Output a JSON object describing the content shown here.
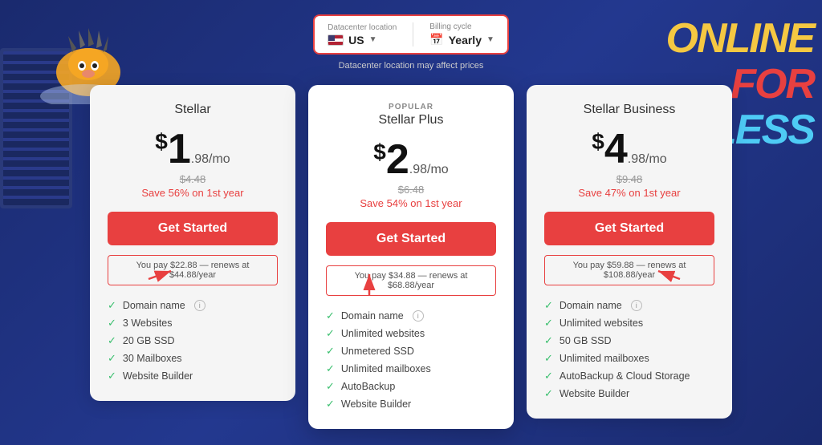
{
  "page": {
    "background_title_line1": "ONLINE",
    "background_title_line2": "FOR",
    "background_title_line3": "LESS"
  },
  "controls": {
    "datacenter_label": "Datacenter location",
    "datacenter_value": "US",
    "billing_label": "Billing cycle",
    "billing_value": "Yearly",
    "note": "Datacenter location may affect prices"
  },
  "plans": [
    {
      "id": "stellar",
      "popular": false,
      "name": "Stellar",
      "currency": "$",
      "price": "1",
      "price_decimal": ".98",
      "period": "/mo",
      "original_price": "$4.48",
      "save_text": "Save 56% on 1st year",
      "cta": "Get Started",
      "renews": "You pay $22.88 — renews at $44.88/year",
      "features": [
        {
          "text": "Domain name",
          "info": true
        },
        {
          "text": "3 Websites",
          "info": false
        },
        {
          "text": "20 GB SSD",
          "info": false
        },
        {
          "text": "30 Mailboxes",
          "info": false
        },
        {
          "text": "Website Builder",
          "info": false
        }
      ]
    },
    {
      "id": "stellar-plus",
      "popular": true,
      "popular_label": "POPULAR",
      "name": "Stellar Plus",
      "currency": "$",
      "price": "2",
      "price_decimal": ".98",
      "period": "/mo",
      "original_price": "$6.48",
      "save_text": "Save 54% on 1st year",
      "cta": "Get Started",
      "renews": "You pay $34.88 — renews at $68.88/year",
      "features": [
        {
          "text": "Domain name",
          "info": true
        },
        {
          "text": "Unlimited websites",
          "info": false
        },
        {
          "text": "Unmetered SSD",
          "info": false
        },
        {
          "text": "Unlimited mailboxes",
          "info": false
        },
        {
          "text": "AutoBackup",
          "info": false
        },
        {
          "text": "Website Builder",
          "info": false
        }
      ]
    },
    {
      "id": "stellar-business",
      "popular": false,
      "name": "Stellar Business",
      "currency": "$",
      "price": "4",
      "price_decimal": ".98",
      "period": "/mo",
      "original_price": "$9.48",
      "save_text": "Save 47% on 1st year",
      "cta": "Get Started",
      "renews": "You pay $59.88 — renews at $108.88/year",
      "features": [
        {
          "text": "Domain name",
          "info": true
        },
        {
          "text": "Unlimited websites",
          "info": false
        },
        {
          "text": "50 GB SSD",
          "info": false
        },
        {
          "text": "Unlimited mailboxes",
          "info": false
        },
        {
          "text": "AutoBackup & Cloud Storage",
          "info": false
        },
        {
          "text": "Website Builder",
          "info": false
        }
      ]
    }
  ]
}
